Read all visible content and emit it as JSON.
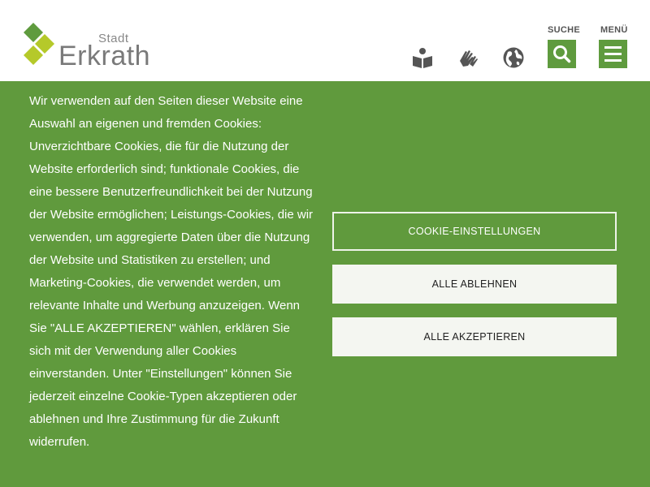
{
  "header": {
    "logo": {
      "prefix": "Stadt",
      "name": "Erkrath"
    },
    "icons": [
      "reading-icon",
      "sign-language-icon",
      "globe-icon"
    ],
    "search_label": "SUCHE",
    "menu_label": "MENÜ"
  },
  "cookie": {
    "text": "Wir verwenden auf den Seiten dieser Website eine Auswahl an eigenen und fremden Cookies: Unverzichtbare Cookies, die für die Nutzung der Website erforderlich sind; funktionale Cookies, die eine bessere Benutzerfreundlichkeit bei der Nutzung der Website ermöglichen; Leistungs-Cookies, die wir verwenden, um aggregierte Daten über die Nutzung der Website und Statistiken zu erstellen; und Marketing-Cookies, die verwendet werden, um relevante Inhalte und Werbung anzuzeigen. Wenn Sie \"ALLE AKZEPTIEREN\" wählen, erklären Sie sich mit der Verwendung aller Cookies einverstanden. Unter \"Einstellungen\" können Sie jederzeit einzelne Cookie-Typen akzeptieren oder ablehnen und Ihre Zustimmung für die Zukunft widerrufen.",
    "buttons": {
      "settings": "COOKIE-EINSTELLUNGEN",
      "reject": "ALLE ABLEHNEN",
      "accept": "ALLE AKZEPTIEREN"
    }
  },
  "colors": {
    "brand_green": "#609a3d",
    "logo_green": "#5f9b3e",
    "logo_lime": "#b5c92a",
    "text_grey": "#7a7a7a"
  }
}
